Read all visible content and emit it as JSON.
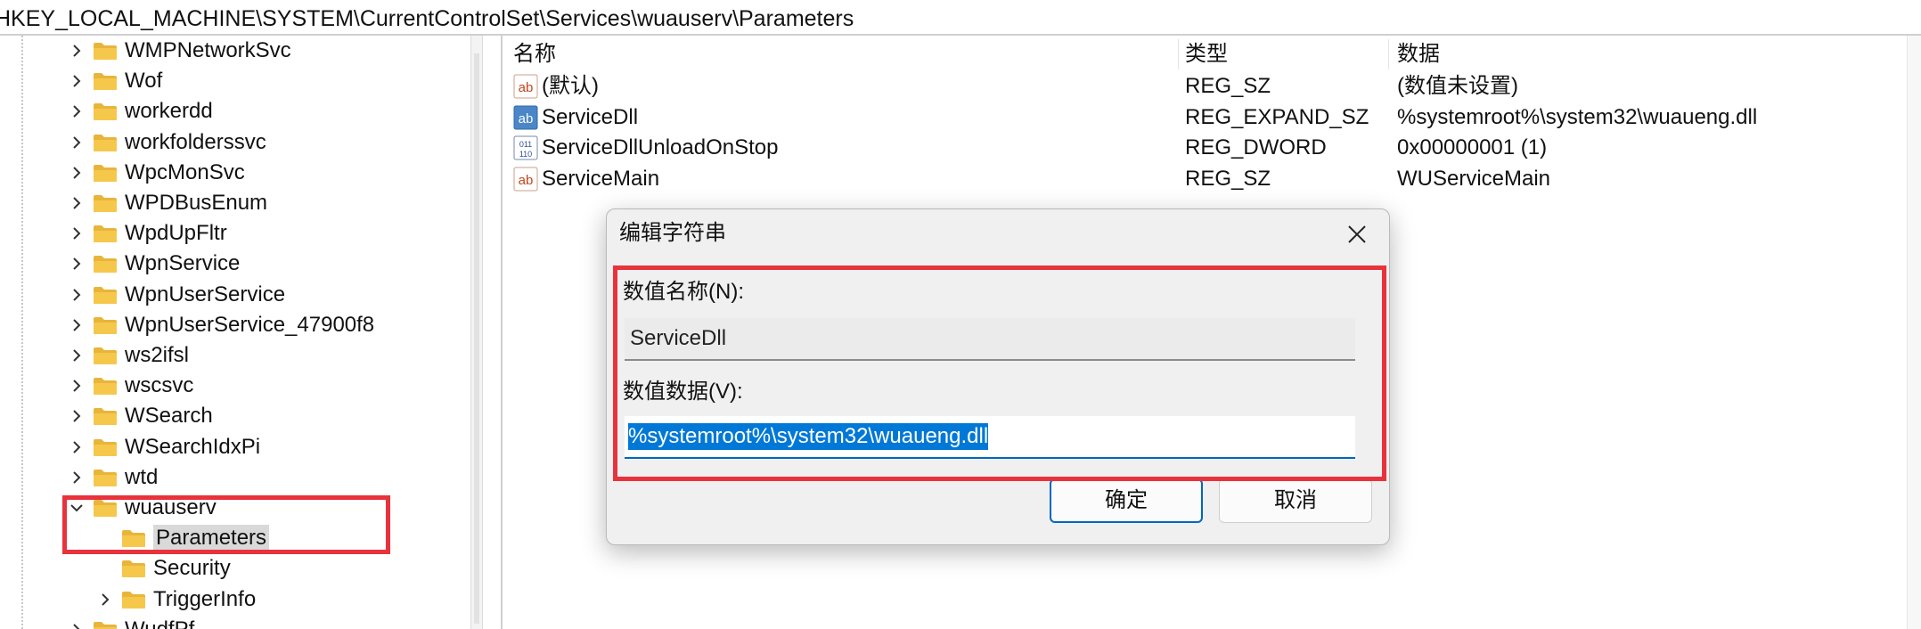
{
  "address_path": "HKEY_LOCAL_MACHINE\\SYSTEM\\CurrentControlSet\\Services\\wuauserv\\Parameters",
  "tree": {
    "items": [
      {
        "label": "WMPNetworkSvc",
        "level": 1,
        "chevron": "right",
        "selected": false
      },
      {
        "label": "Wof",
        "level": 1,
        "chevron": "right",
        "selected": false
      },
      {
        "label": "workerdd",
        "level": 1,
        "chevron": "right",
        "selected": false
      },
      {
        "label": "workfolderssvc",
        "level": 1,
        "chevron": "right",
        "selected": false
      },
      {
        "label": "WpcMonSvc",
        "level": 1,
        "chevron": "right",
        "selected": false
      },
      {
        "label": "WPDBusEnum",
        "level": 1,
        "chevron": "right",
        "selected": false
      },
      {
        "label": "WpdUpFltr",
        "level": 1,
        "chevron": "right",
        "selected": false
      },
      {
        "label": "WpnService",
        "level": 1,
        "chevron": "right",
        "selected": false
      },
      {
        "label": "WpnUserService",
        "level": 1,
        "chevron": "right",
        "selected": false
      },
      {
        "label": "WpnUserService_47900f8",
        "level": 1,
        "chevron": "right",
        "selected": false
      },
      {
        "label": "ws2ifsl",
        "level": 1,
        "chevron": "right",
        "selected": false
      },
      {
        "label": "wscsvc",
        "level": 1,
        "chevron": "right",
        "selected": false
      },
      {
        "label": "WSearch",
        "level": 1,
        "chevron": "right",
        "selected": false
      },
      {
        "label": "WSearchIdxPi",
        "level": 1,
        "chevron": "right",
        "selected": false
      },
      {
        "label": "wtd",
        "level": 1,
        "chevron": "right",
        "selected": false
      },
      {
        "label": "wuauserv",
        "level": 1,
        "chevron": "down",
        "selected": false
      },
      {
        "label": "Parameters",
        "level": 2,
        "chevron": "none",
        "selected": true
      },
      {
        "label": "Security",
        "level": 2,
        "chevron": "none",
        "selected": false
      },
      {
        "label": "TriggerInfo",
        "level": 2,
        "chevron": "right",
        "selected": false
      },
      {
        "label": "WudfPf",
        "level": 1,
        "chevron": "right",
        "selected": false
      }
    ]
  },
  "list": {
    "headers": {
      "name": "名称",
      "type": "类型",
      "data": "数据"
    },
    "rows": [
      {
        "icon": "string-value-icon",
        "name": "(默认)",
        "type": "REG_SZ",
        "data": "(数值未设置)"
      },
      {
        "icon": "expand-string-value-icon",
        "name": "ServiceDll",
        "type": "REG_EXPAND_SZ",
        "data": "%systemroot%\\system32\\wuaueng.dll"
      },
      {
        "icon": "dword-value-icon",
        "name": "ServiceDllUnloadOnStop",
        "type": "REG_DWORD",
        "data": "0x00000001 (1)"
      },
      {
        "icon": "string-value-icon",
        "name": "ServiceMain",
        "type": "REG_SZ",
        "data": "WUServiceMain"
      }
    ]
  },
  "dialog": {
    "title": "编辑字符串",
    "name_label": "数值名称(N):",
    "name_value": "ServiceDll",
    "data_label": "数值数据(V):",
    "data_value": "%systemroot%\\system32\\wuaueng.dll",
    "ok_label": "确定",
    "cancel_label": "取消",
    "close_icon": "close-icon"
  },
  "colors": {
    "highlight": "#e8323c",
    "selection": "#0078d7",
    "folder": "#f5c84c"
  }
}
